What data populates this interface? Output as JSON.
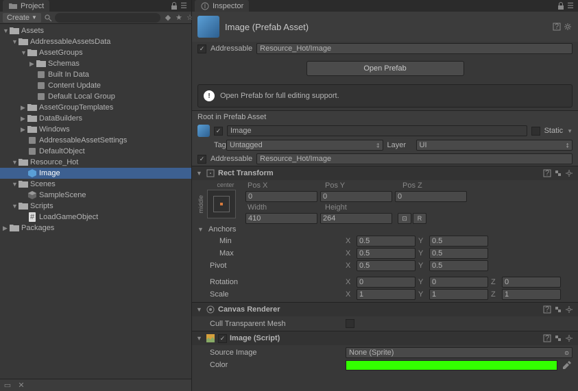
{
  "project": {
    "tab": "Project",
    "create": "Create",
    "tree": [
      {
        "d": 0,
        "label": "Assets",
        "icon": "folder",
        "arrow": "▼"
      },
      {
        "d": 1,
        "label": "AddressableAssetsData",
        "icon": "folder",
        "arrow": "▼"
      },
      {
        "d": 2,
        "label": "AssetGroups",
        "icon": "folder",
        "arrow": "▼"
      },
      {
        "d": 3,
        "label": "Schemas",
        "icon": "folder",
        "arrow": "▶"
      },
      {
        "d": 3,
        "label": "Built In Data",
        "icon": "asset",
        "arrow": ""
      },
      {
        "d": 3,
        "label": "Content Update",
        "icon": "asset",
        "arrow": ""
      },
      {
        "d": 3,
        "label": "Default Local Group",
        "icon": "asset",
        "arrow": ""
      },
      {
        "d": 2,
        "label": "AssetGroupTemplates",
        "icon": "folder",
        "arrow": "▶"
      },
      {
        "d": 2,
        "label": "DataBuilders",
        "icon": "folder",
        "arrow": "▶"
      },
      {
        "d": 2,
        "label": "Windows",
        "icon": "folder",
        "arrow": "▶"
      },
      {
        "d": 2,
        "label": "AddressableAssetSettings",
        "icon": "asset",
        "arrow": ""
      },
      {
        "d": 2,
        "label": "DefaultObject",
        "icon": "asset",
        "arrow": ""
      },
      {
        "d": 1,
        "label": "Resource_Hot",
        "icon": "folder",
        "arrow": "▼"
      },
      {
        "d": 2,
        "label": "Image",
        "icon": "prefab",
        "arrow": "",
        "selected": true
      },
      {
        "d": 1,
        "label": "Scenes",
        "icon": "folder",
        "arrow": "▼"
      },
      {
        "d": 2,
        "label": "SampleScene",
        "icon": "scene",
        "arrow": ""
      },
      {
        "d": 1,
        "label": "Scripts",
        "icon": "folder",
        "arrow": "▼"
      },
      {
        "d": 2,
        "label": "LoadGameObject",
        "icon": "script",
        "arrow": ""
      },
      {
        "d": 0,
        "label": "Packages",
        "icon": "folder",
        "arrow": "▶"
      }
    ]
  },
  "inspector": {
    "tab": "Inspector",
    "title": "Image (Prefab Asset)",
    "addressable_label": "Addressable",
    "addressable_value": "Resource_Hot/Image",
    "open_prefab": "Open Prefab",
    "info": "Open Prefab for full editing support.",
    "root_section": "Root in Prefab Asset",
    "name": "Image",
    "static_label": "Static",
    "tag_label": "Tag",
    "tag_value": "Untagged",
    "layer_label": "Layer",
    "layer_value": "UI",
    "addressable2_label": "Addressable",
    "addressable2_value": "Resource_Hot/Image",
    "rect": {
      "title": "Rect Transform",
      "center": "center",
      "middle": "middle",
      "posx": "Pos X",
      "posy": "Pos Y",
      "posz": "Pos Z",
      "px": "0",
      "py": "0",
      "pz": "0",
      "width_l": "Width",
      "height_l": "Height",
      "width": "410",
      "height": "264",
      "anchors": "Anchors",
      "min": "Min",
      "max": "Max",
      "minx": "0.5",
      "miny": "0.5",
      "maxx": "0.5",
      "maxy": "0.5",
      "pivot": "Pivot",
      "pivx": "0.5",
      "pivy": "0.5",
      "rotation": "Rotation",
      "rx": "0",
      "ry": "0",
      "rz": "0",
      "scale": "Scale",
      "sx": "1",
      "sy": "1",
      "sz": "1",
      "btn_r": "R"
    },
    "canvas": {
      "title": "Canvas Renderer",
      "cull": "Cull Transparent Mesh"
    },
    "image": {
      "title": "Image (Script)",
      "source_l": "Source Image",
      "source_v": "None (Sprite)",
      "color_l": "Color",
      "color_v": "#33ff00"
    }
  }
}
